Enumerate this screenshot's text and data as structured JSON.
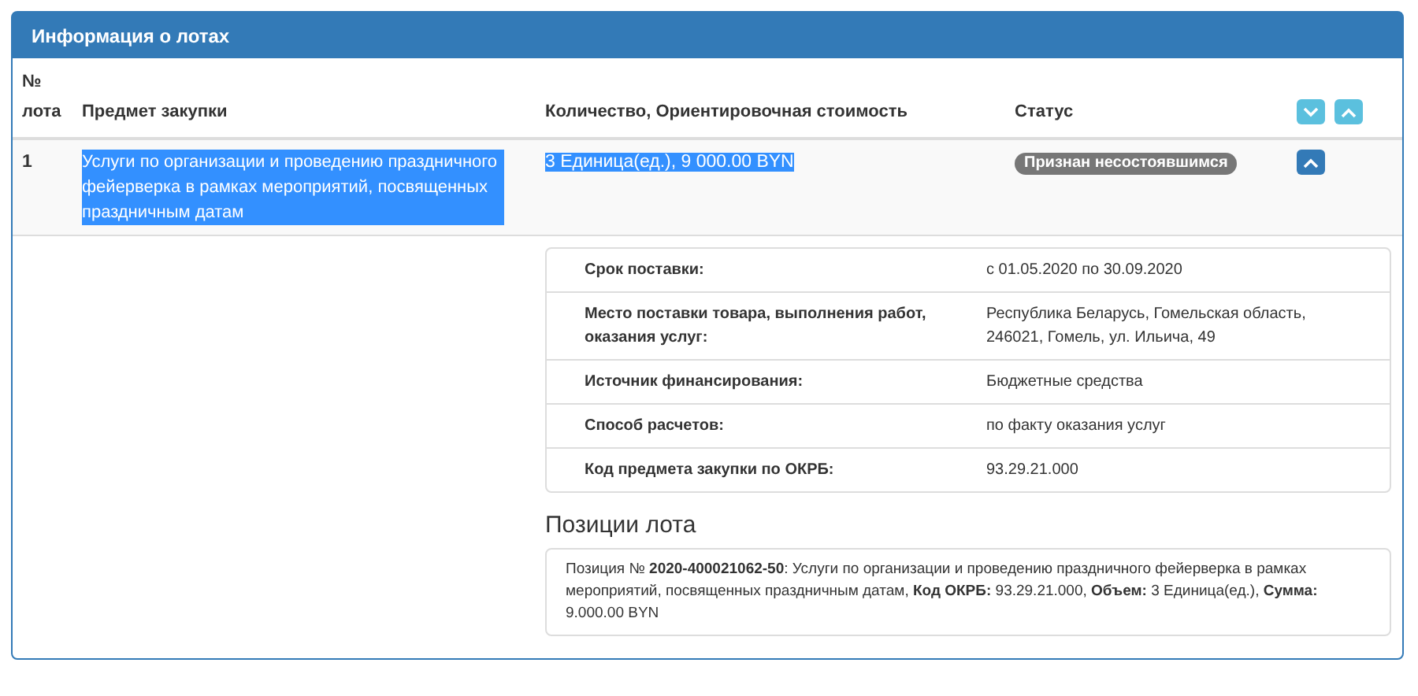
{
  "panel": {
    "title": "Информация о лотах"
  },
  "table": {
    "columns": [
      {
        "label": "№ лота"
      },
      {
        "label": "Предмет закупки"
      },
      {
        "label": "Количество, Ориентировочная стоимость"
      },
      {
        "label": "Статус"
      }
    ],
    "rows": [
      {
        "number": "1",
        "subject": "Услуги по организации и проведению праздничного фейерверка в рамках мероприятий, посвященных праздничным датам",
        "quantity": "3 Единица(ед.), 9 000.00 BYN",
        "status": "Признан несостоявшимся",
        "highlighted": true,
        "expanded": true
      }
    ]
  },
  "details": [
    {
      "label": "Срок поставки:",
      "value": "с 01.05.2020 по 30.09.2020"
    },
    {
      "label": "Место поставки товара, выполнения работ, оказания услуг:",
      "value": "Республика Беларусь, Гомельская область, 246021, Гомель, ул. Ильича, 49"
    },
    {
      "label": "Источник финансирования:",
      "value": "Бюджетные средства"
    },
    {
      "label": "Способ расчетов:",
      "value": "по факту оказания услуг"
    },
    {
      "label": "Код предмета закупки по ОКРБ:",
      "value": "93.29.21.000"
    }
  ],
  "positions": {
    "title": "Позиции лота",
    "items": [
      "Позиция № **2020-400021062-50**: Услуги по организации и проведению праздничного фейерверка в рамках мероприятий, посвященных праздничным датам, **Код ОКРБ:** 93.29.21.000, **Объем:** 3 Единица(ед.), **Сумма:** 9.000.00 BYN"
    ]
  }
}
